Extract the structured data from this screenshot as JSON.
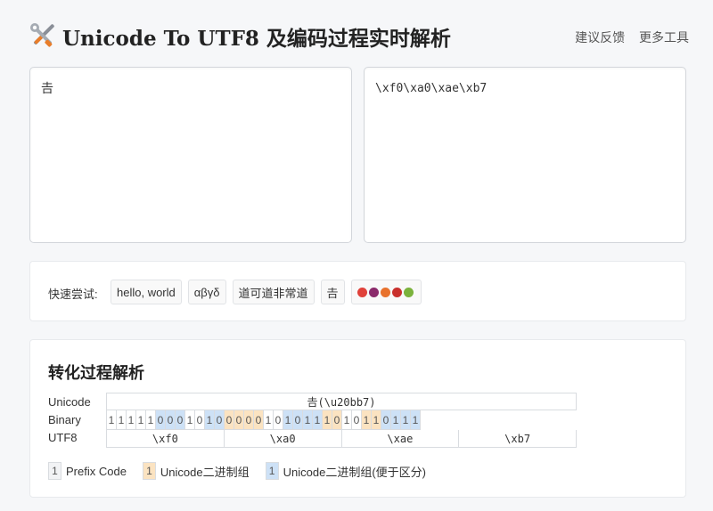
{
  "header": {
    "title": "Unicode To UTF8 及编码过程实时解析",
    "nav": [
      "建议反馈",
      "更多工具"
    ]
  },
  "input": {
    "value": "𠮷"
  },
  "output": {
    "value": "\\xf0\\xa0\\xae\\xb7"
  },
  "quick": {
    "label": "快速尝试:",
    "chips": [
      "hello, world",
      "αβγδ",
      "道可道非常道",
      "𠮷"
    ],
    "fruit_colors": [
      "#e0413a",
      "#8b2a6b",
      "#e8722d",
      "#c9302c",
      "#7bb23c"
    ]
  },
  "panel": {
    "title": "转化过程解析",
    "labels": [
      "Unicode",
      "Binary",
      "UTF8"
    ],
    "unicode_value": "𠮷(\\u20bb7)",
    "bits": [
      {
        "v": "1",
        "t": "prefix"
      },
      {
        "v": "1",
        "t": "prefix"
      },
      {
        "v": "1",
        "t": "prefix"
      },
      {
        "v": "1",
        "t": "prefix"
      },
      {
        "v": "1",
        "t": "prefix"
      },
      {
        "v": "0",
        "t": "blue"
      },
      {
        "v": "0",
        "t": "blue"
      },
      {
        "v": "0",
        "t": "blue"
      },
      {
        "v": "1",
        "t": "prefix"
      },
      {
        "v": "0",
        "t": "prefix"
      },
      {
        "v": "1",
        "t": "blue"
      },
      {
        "v": "0",
        "t": "blue"
      },
      {
        "v": "0",
        "t": "orange"
      },
      {
        "v": "0",
        "t": "orange"
      },
      {
        "v": "0",
        "t": "orange"
      },
      {
        "v": "0",
        "t": "orange"
      },
      {
        "v": "1",
        "t": "prefix"
      },
      {
        "v": "0",
        "t": "prefix"
      },
      {
        "v": "1",
        "t": "blue"
      },
      {
        "v": "0",
        "t": "blue"
      },
      {
        "v": "1",
        "t": "blue"
      },
      {
        "v": "1",
        "t": "blue"
      },
      {
        "v": "1",
        "t": "orange"
      },
      {
        "v": "0",
        "t": "orange"
      },
      {
        "v": "1",
        "t": "prefix"
      },
      {
        "v": "0",
        "t": "prefix"
      },
      {
        "v": "1",
        "t": "orange"
      },
      {
        "v": "1",
        "t": "orange"
      },
      {
        "v": "0",
        "t": "blue"
      },
      {
        "v": "1",
        "t": "blue"
      },
      {
        "v": "1",
        "t": "blue"
      },
      {
        "v": "1",
        "t": "blue"
      }
    ],
    "bytes": [
      "\\xf0",
      "\\xa0",
      "\\xae",
      "\\xb7"
    ],
    "legend": [
      {
        "num": "1",
        "label": "Prefix Code"
      },
      {
        "num": "1",
        "label": "Unicode二进制组"
      },
      {
        "num": "1",
        "label": "Unicode二进制组(便于区分)"
      }
    ]
  },
  "colors": {
    "orange": "#fbe3c1",
    "blue": "#cde1f6",
    "border": "#d9dce0"
  },
  "icons": {
    "logo": "tools-icon"
  }
}
